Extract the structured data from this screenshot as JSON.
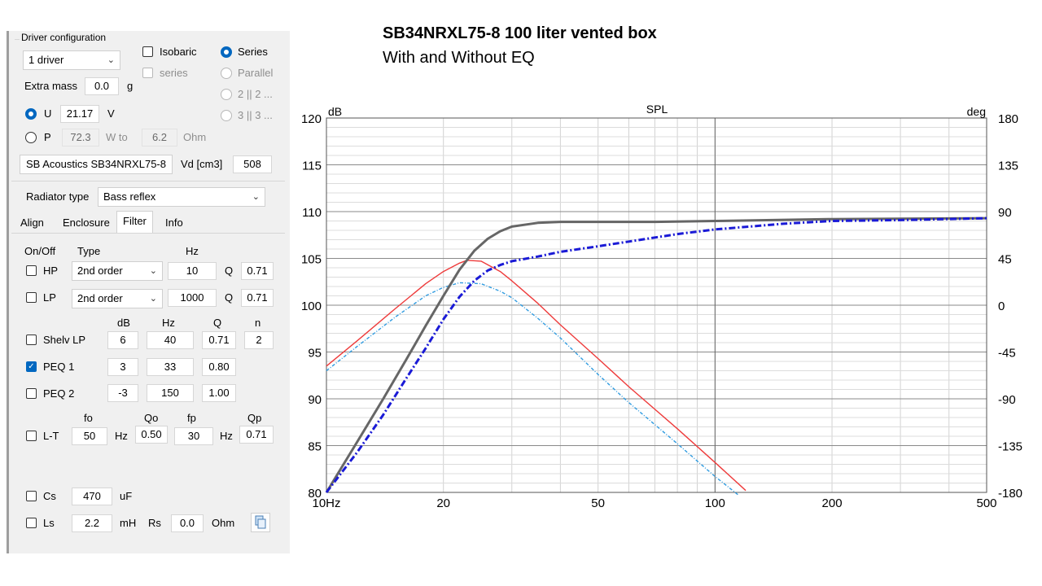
{
  "driver_config": {
    "title": "Driver configuration",
    "driver_count": "1 driver",
    "isobaric_label": "Isobaric",
    "series_sub_label": "series",
    "series_label": "Series",
    "parallel_label": "Parallel",
    "two_parallel_label": "2 || 2 ...",
    "three_parallel_label": "3 || 3 ...",
    "extra_mass_label": "Extra mass",
    "extra_mass_value": "0.0",
    "extra_mass_unit": "g",
    "u_label": "U",
    "u_value": "21.17",
    "u_unit": "V",
    "p_label": "P",
    "p_value": "72.3",
    "p_unit": "W to",
    "ohm_value": "6.2",
    "ohm_unit": "Ohm",
    "driver_name": "SB Acoustics SB34NRXL75-8",
    "vd_label": "Vd [cm3]",
    "vd_value": "508"
  },
  "radiator": {
    "label": "Radiator type",
    "value": "Bass reflex"
  },
  "tabs": [
    "Align",
    "Enclosure",
    "Filter",
    "Info"
  ],
  "filter": {
    "onoff_header": "On/Off",
    "type_header": "Type",
    "hz_header": "Hz",
    "hp": {
      "label": "HP",
      "type": "2nd order",
      "hz": "10",
      "q_label": "Q",
      "q": "0.71"
    },
    "lp": {
      "label": "LP",
      "type": "2nd order",
      "hz": "1000",
      "q_label": "Q",
      "q": "0.71"
    },
    "col_db": "dB",
    "col_hz": "Hz",
    "col_q": "Q",
    "col_n": "n",
    "shelv": {
      "label": "Shelv LP",
      "db": "6",
      "hz": "40",
      "q": "0.71",
      "n": "2"
    },
    "peq1": {
      "label": "PEQ 1",
      "db": "3",
      "hz": "33",
      "q": "0.80"
    },
    "peq2": {
      "label": "PEQ 2",
      "db": "-3",
      "hz": "150",
      "q": "1.00"
    },
    "lt_col_fo": "fo",
    "lt_col_qo": "Qo",
    "lt_col_fp": "fp",
    "lt_col_qp": "Qp",
    "lt": {
      "label": "L-T",
      "fo": "50",
      "hz1": "Hz",
      "qo": "0.50",
      "fp": "30",
      "hz2": "Hz",
      "qp": "0.71"
    },
    "cs": {
      "label": "Cs",
      "value": "470",
      "unit": "uF"
    },
    "ls": {
      "label": "Ls",
      "value": "2.2",
      "unit": "mH",
      "rs_label": "Rs",
      "rs_value": "0.0",
      "rs_unit": "Ohm"
    }
  },
  "chart_title": "SB34NRXL75-8  100 liter vented box",
  "chart_subtitle": "With and Without EQ",
  "chart_data": {
    "type": "line",
    "title": "SPL",
    "ylabel_left": "dB",
    "ylabel_right": "deg",
    "x_scale": "log",
    "xlim": [
      10,
      500
    ],
    "ylim": [
      80,
      120
    ],
    "y2lim": [
      -180,
      180
    ],
    "x_tick_labels": [
      "10Hz",
      "20",
      "50",
      "100",
      "200",
      "500"
    ],
    "y_tick_labels": [
      "80",
      "85",
      "90",
      "95",
      "100",
      "105",
      "110",
      "115",
      "120"
    ],
    "y2_tick_labels": [
      "-180",
      "-135",
      "-90",
      "-45",
      "0",
      "45",
      "90",
      "135",
      "180"
    ],
    "grid": true,
    "series": [
      {
        "axis": "left",
        "color": "#ee3b3b",
        "dash": "none",
        "x": [
          10,
          12,
          15,
          18,
          20,
          22,
          23,
          25,
          28,
          30,
          35,
          40,
          50,
          60,
          80,
          100,
          120
        ],
        "y": [
          93.5,
          96.2,
          99.6,
          102.3,
          103.6,
          104.5,
          104.8,
          104.7,
          103.6,
          102.6,
          100.2,
          97.9,
          94.3,
          91.3,
          86.8,
          83.2,
          80.2
        ]
      },
      {
        "axis": "left",
        "color": "#2f9be0",
        "dash": "4,2,1,2",
        "x": [
          10,
          12,
          15,
          18,
          20,
          22,
          25,
          28,
          30,
          35,
          40,
          50,
          60,
          80,
          100,
          115
        ],
        "y": [
          93.0,
          95.6,
          98.7,
          101.0,
          101.9,
          102.4,
          102.3,
          101.5,
          100.8,
          98.6,
          96.5,
          92.6,
          89.6,
          85.2,
          81.7,
          79.7
        ]
      },
      {
        "axis": "left",
        "color": "#666666",
        "dash": "none",
        "x": [
          10,
          12,
          14,
          16,
          18,
          20,
          22,
          24,
          26,
          28,
          30,
          35,
          40,
          50,
          70,
          100,
          200,
          500
        ],
        "y": [
          80.0,
          85.4,
          90.0,
          94.1,
          97.8,
          101.0,
          103.8,
          105.8,
          107.1,
          107.9,
          108.4,
          108.8,
          108.9,
          108.9,
          108.9,
          109.0,
          109.2,
          109.3
        ]
      },
      {
        "axis": "left",
        "color": "#1a1ad6",
        "dash": "8,3,2,3",
        "x": [
          10,
          12,
          14,
          16,
          18,
          20,
          22,
          24,
          26,
          28,
          30,
          35,
          40,
          50,
          60,
          80,
          100,
          150,
          200,
          300,
          500
        ],
        "y": [
          80.0,
          84.3,
          88.3,
          92.1,
          95.4,
          98.5,
          100.9,
          102.6,
          103.7,
          104.3,
          104.7,
          105.2,
          105.7,
          106.3,
          106.8,
          107.6,
          108.1,
          108.7,
          109.0,
          109.1,
          109.3
        ]
      }
    ]
  }
}
